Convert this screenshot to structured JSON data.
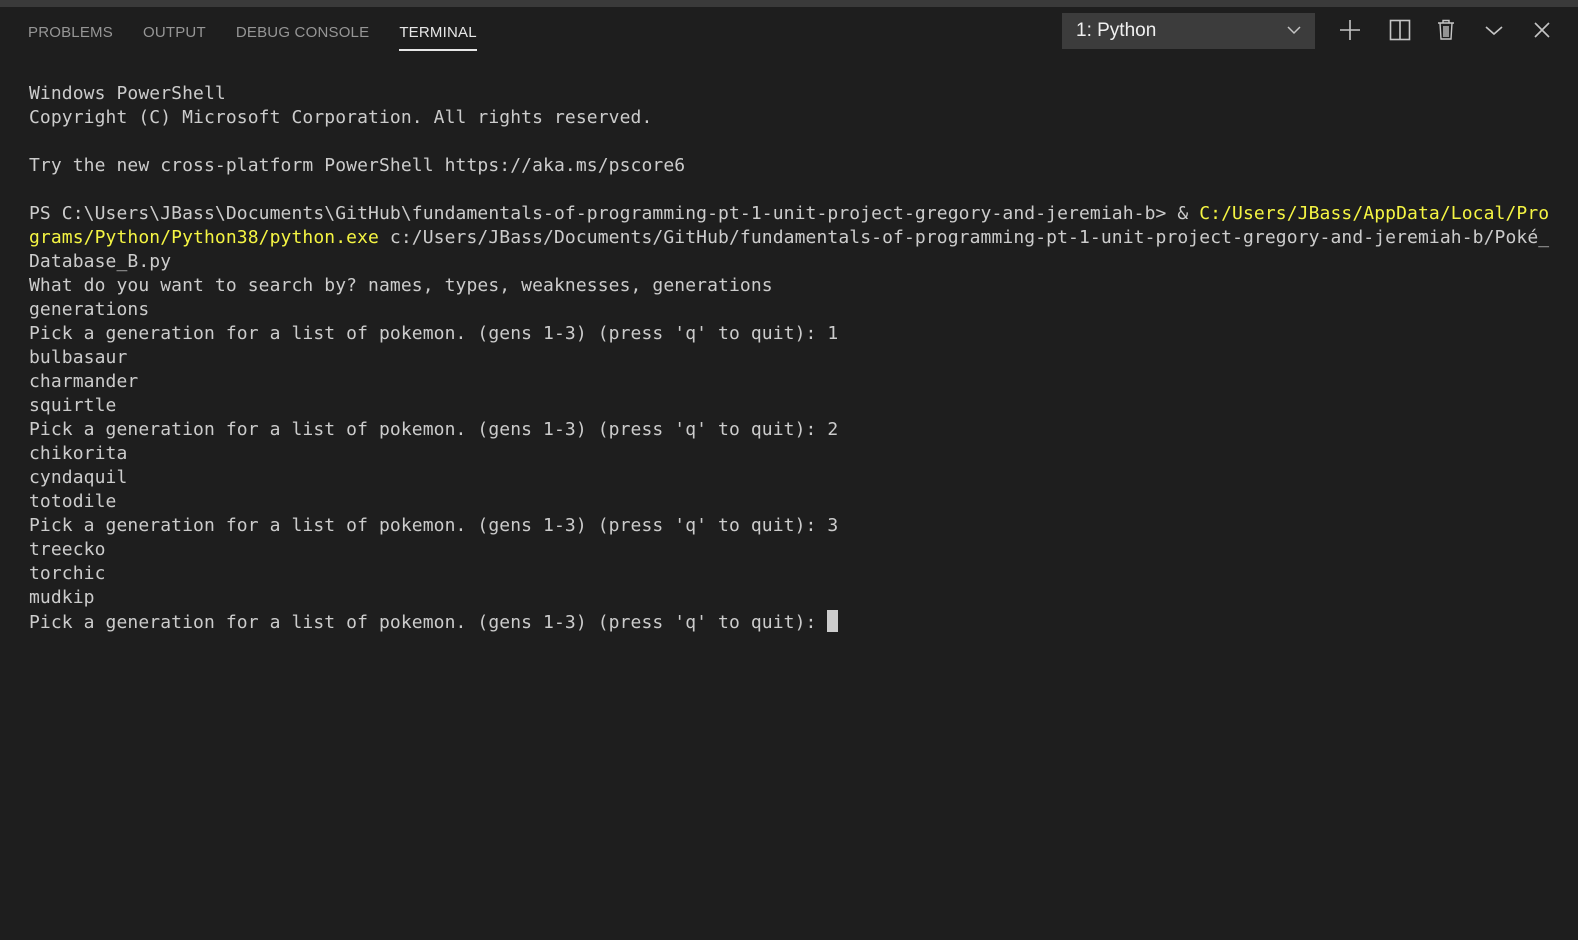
{
  "panel": {
    "tabs": [
      {
        "label": "PROBLEMS",
        "active": false
      },
      {
        "label": "OUTPUT",
        "active": false
      },
      {
        "label": "DEBUG CONSOLE",
        "active": false
      },
      {
        "label": "TERMINAL",
        "active": true
      }
    ],
    "terminal_select": "1: Python",
    "icons": [
      "plus-icon",
      "split-icon",
      "trash-icon",
      "chevron-down-icon",
      "close-icon"
    ]
  },
  "terminal": {
    "l1": "Windows PowerShell",
    "l2": "Copyright (C) Microsoft Corporation. All rights reserved.",
    "l3": "Try the new cross-platform PowerShell https://aka.ms/pscore6",
    "ps_prompt": "PS C:\\Users\\JBass\\Documents\\GitHub\\fundamentals-of-programming-pt-1-unit-project-gregory-and-jeremiah-b> & ",
    "ps_exe_a": "C:/Users/JBass/AppData/Local/Pro",
    "ps_exe_b": "grams/Python/Python38/python.exe",
    "ps_arg_a": " c:/Users/JBass/Documents/GitHub/fundamentals-of-programming-pt-1-unit-project-gregory-and-jeremiah-b/Poké_",
    "ps_arg_b": "Database_B.py",
    "lines": [
      "What do you want to search by? names, types, weaknesses, generations",
      "generations",
      "Pick a generation for a list of pokemon. (gens 1-3) (press 'q' to quit): 1",
      "bulbasaur",
      "charmander",
      "squirtle",
      "Pick a generation for a list of pokemon. (gens 1-3) (press 'q' to quit): 2",
      "chikorita",
      "cyndaquil",
      "totodile",
      "Pick a generation for a list of pokemon. (gens 1-3) (press 'q' to quit): 3",
      "treecko",
      "torchic",
      "mudkip"
    ],
    "current_prompt": "Pick a generation for a list of pokemon. (gens 1-3) (press 'q' to quit): "
  }
}
